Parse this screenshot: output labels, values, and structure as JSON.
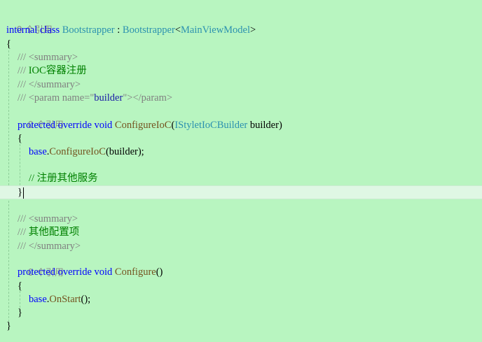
{
  "codelens": {
    "references": "0 个引用"
  },
  "class_decl": {
    "internal": "internal",
    "class": "class",
    "name": "Bootstrapper",
    "colon": " : ",
    "base": "Bootstrapper",
    "lt": "<",
    "generic": "MainViewModel",
    "gt": ">"
  },
  "braces": {
    "open": "{",
    "close": "}"
  },
  "doc1": {
    "prefix": "/// ",
    "summary_open": "<summary>",
    "text": "IOC容器注册",
    "summary_close": "</summary>",
    "param_open_a": "<param name=\"",
    "param_name": "builder",
    "param_open_b": "\">",
    "param_close": "</param>"
  },
  "method1": {
    "protected": "protected",
    "override": "override",
    "void": "void",
    "name": "ConfigureIoC",
    "paren_open": "(",
    "param_type": "IStyletIoCBuilder",
    "param_name": " builder",
    "paren_close": ")",
    "body_base": "base",
    "body_dot": ".",
    "body_call": "ConfigureIoC",
    "body_args": "(builder);",
    "comment": "// 注册其他服务"
  },
  "doc2": {
    "prefix": "/// ",
    "summary_open": "<summary>",
    "text": "其他配置项",
    "summary_close": "</summary>"
  },
  "method2": {
    "protected": "protected",
    "override": "override",
    "void": "void",
    "name": "Configure",
    "parens": "()",
    "body_base": "base",
    "body_dot": ".",
    "body_call": "OnStart",
    "body_args": "();"
  },
  "colors": {
    "background": "#b8f5c0",
    "keyword": "#0000ff",
    "type": "#2b91af",
    "method": "#74531f",
    "comment": "#008000",
    "doc_tag": "#808080"
  }
}
